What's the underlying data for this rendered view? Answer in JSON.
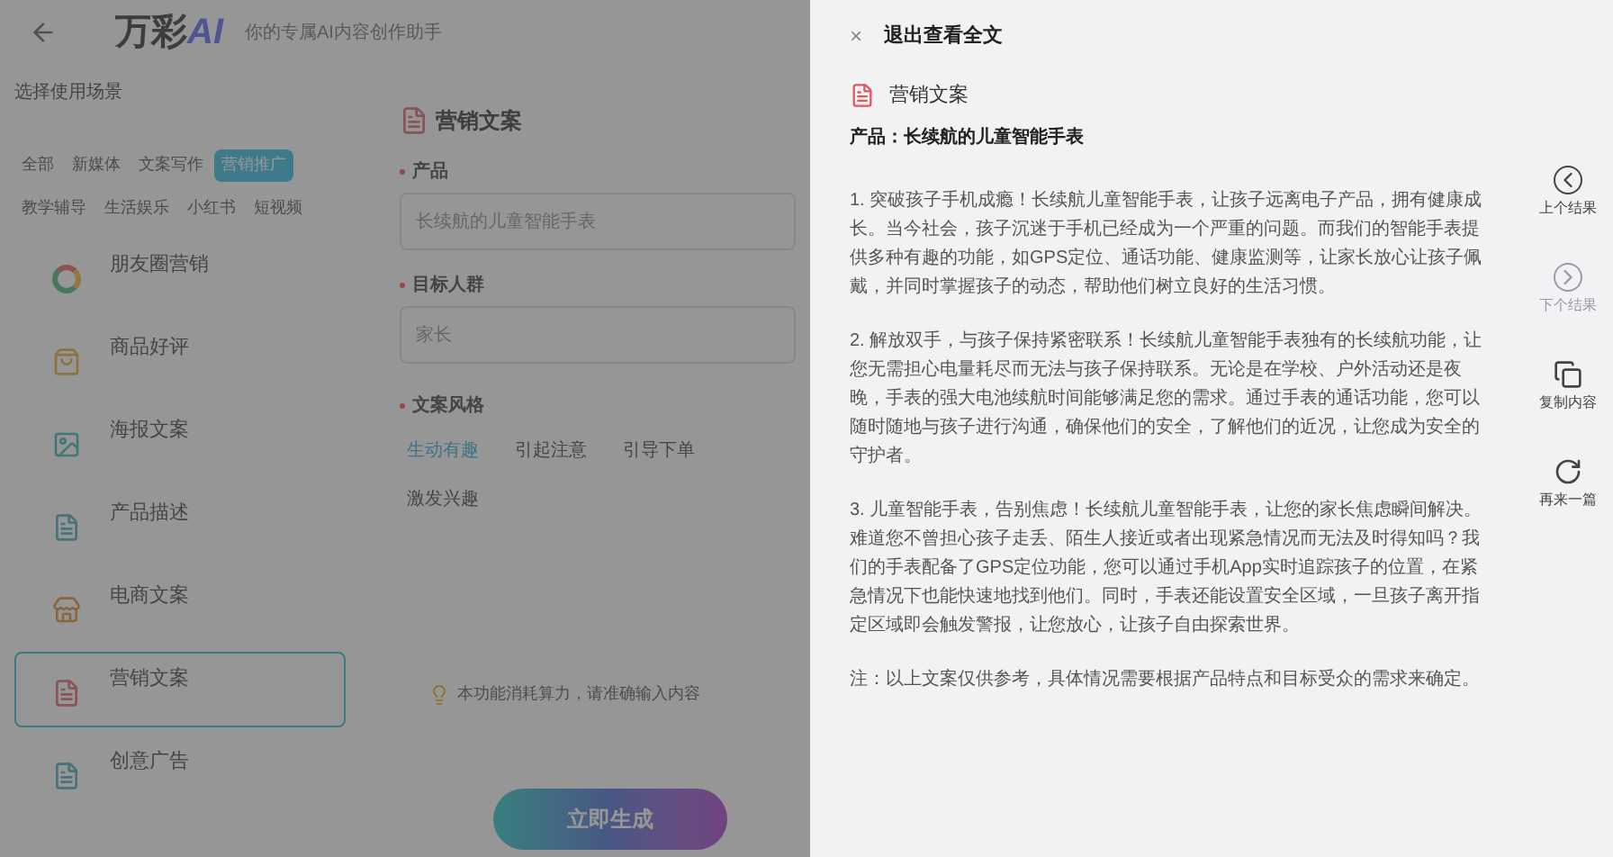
{
  "header": {
    "logo": "万彩",
    "logo_accent": "AI",
    "subtitle": "你的专属AI内容创作助手"
  },
  "scene_panel": {
    "title": "选择使用场景",
    "categories": [
      {
        "label": "全部",
        "selected": false
      },
      {
        "label": "新媒体",
        "selected": false
      },
      {
        "label": "文案写作",
        "selected": false
      },
      {
        "label": "营销推广",
        "selected": true
      },
      {
        "label": "教学辅导",
        "selected": false
      },
      {
        "label": "生活娱乐",
        "selected": false
      },
      {
        "label": "小红书",
        "selected": false
      },
      {
        "label": "短视频",
        "selected": false
      }
    ],
    "templates": [
      {
        "name": "朋友圈营销",
        "kind": "ring",
        "selected": false
      },
      {
        "name": "商品好评",
        "kind": "bag",
        "selected": false
      },
      {
        "name": "海报文案",
        "kind": "poster",
        "selected": false
      },
      {
        "name": "产品描述",
        "kind": "doc",
        "selected": false
      },
      {
        "name": "电商文案",
        "kind": "shop",
        "selected": false
      },
      {
        "name": "营销文案",
        "kind": "marketing",
        "selected": true
      },
      {
        "name": "创意广告",
        "kind": "doc",
        "selected": false
      }
    ]
  },
  "form": {
    "title": "营销文案",
    "fields": [
      {
        "label": "产品",
        "placeholder": "长续航的儿童智能手表",
        "required": true
      },
      {
        "label": "目标人群",
        "placeholder": "家长",
        "required": true
      }
    ],
    "style_label": "文案风格",
    "style_required": true,
    "styles": [
      {
        "label": "生动有趣",
        "selected": true
      },
      {
        "label": "引起注意",
        "selected": false
      },
      {
        "label": "引导下单",
        "selected": false
      },
      {
        "label": "激发兴趣",
        "selected": false
      }
    ],
    "tip": "本功能消耗算力，请准确输入内容",
    "submit": "立即生成"
  },
  "drawer": {
    "close": "×",
    "title": "退出查看全文",
    "doc_type": "营销文案",
    "product": "产品：长续航的儿童智能手表",
    "paragraphs": [
      "1. 突破孩子手机成瘾！长续航儿童智能手表，让孩子远离电子产品，拥有健康成长。当今社会，孩子沉迷于手机已经成为一个严重的问题。而我们的智能手表提供多种有趣的功能，如GPS定位、通话功能、健康监测等，让家长放心让孩子佩戴，并同时掌握孩子的动态，帮助他们树立良好的生活习惯。",
      "2. 解放双手，与孩子保持紧密联系！长续航儿童智能手表独有的长续航功能，让您无需担心电量耗尽而无法与孩子保持联系。无论是在学校、户外活动还是夜晚，手表的强大电池续航时间能够满足您的需求。通过手表的通话功能，您可以随时随地与孩子进行沟通，确保他们的安全，了解他们的近况，让您成为安全的守护者。",
      "3. 儿童智能手表，告别焦虑！长续航儿童智能手表，让您的家长焦虑瞬间解决。难道您不曾担心孩子走丢、陌生人接近或者出现紧急情况而无法及时得知吗？我们的手表配备了GPS定位功能，您可以通过手机App实时追踪孩子的位置，在紧急情况下也能快速地找到他们。同时，手表还能设置安全区域，一旦孩子离开指定区域即会触发警报，让您放心，让孩子自由探索世界。",
      "注：以上文案仅供参考，具体情况需要根据产品特点和目标受众的需求来确定。"
    ],
    "actions": [
      {
        "label": "上个结果",
        "kind": "prev",
        "disabled": false
      },
      {
        "label": "下个结果",
        "kind": "next",
        "disabled": true
      },
      {
        "label": "复制内容",
        "kind": "copy",
        "disabled": false
      },
      {
        "label": "再来一篇",
        "kind": "again",
        "disabled": false
      }
    ]
  }
}
